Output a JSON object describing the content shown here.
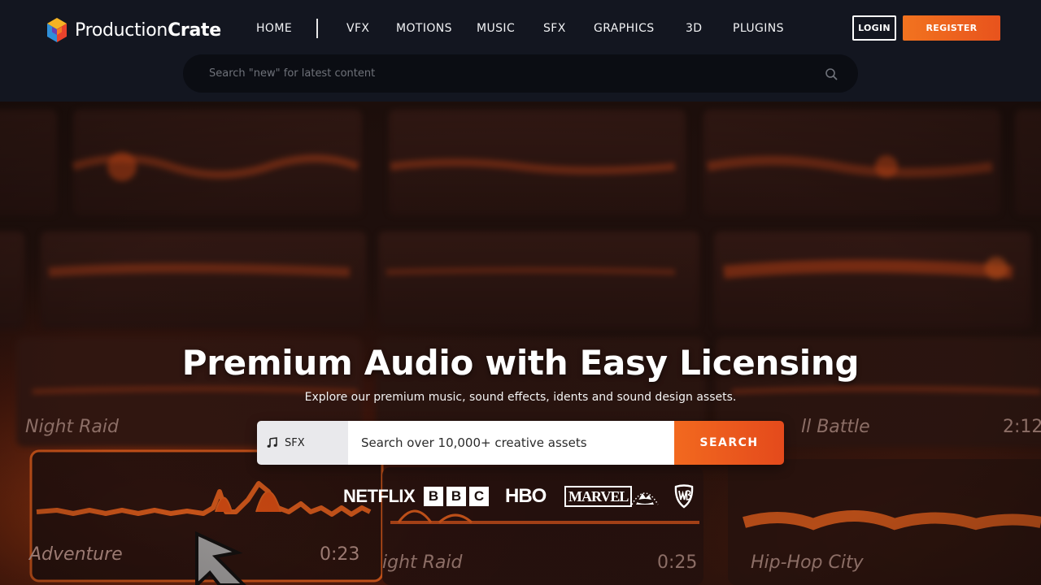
{
  "header": {
    "logo": {
      "text_regular": "Production",
      "text_bold": "Crate"
    },
    "nav": [
      {
        "label": "HOME"
      },
      {
        "label": "VFX"
      },
      {
        "label": "MOTIONS"
      },
      {
        "label": "MUSIC"
      },
      {
        "label": "SFX"
      },
      {
        "label": "GRAPHICS"
      },
      {
        "label": "3D"
      },
      {
        "label": "PLUGINS"
      }
    ],
    "login_label": "LOGIN",
    "register_label": "REGISTER",
    "search": {
      "placeholder": "Search \"new\" for latest content",
      "icon": "search-icon"
    }
  },
  "hero": {
    "title": "Premium Audio with Easy Licensing",
    "subtitle": "Explore our premium music, sound effects, idents and sound design assets.",
    "search": {
      "category": "SFX",
      "category_icon": "music-note-icon",
      "placeholder": "Search over 10,000+ creative assets",
      "button_label": "SEARCH"
    },
    "brands": {
      "netflix": "NETFLIX",
      "bbc": [
        "B",
        "B",
        "C"
      ],
      "hbo": "HBO",
      "marvel": "MARVEL",
      "paramount_icon": "paramount-logo",
      "wb_icon": "warner-bros-logo"
    },
    "background_cards": [
      {
        "title": "Night Raid"
      },
      {
        "title": "ll Battle",
        "time": "2:12"
      },
      {
        "title": "Adventure",
        "time": "0:23"
      },
      {
        "title": "ight Raid",
        "time": "0:25"
      },
      {
        "title": "Hip-Hop City"
      }
    ]
  },
  "colors": {
    "header_bg": "#131620",
    "accent_orange": "#f2731f",
    "accent_orange_dark": "#e44a1c",
    "search_bg": "#0b0d13"
  }
}
